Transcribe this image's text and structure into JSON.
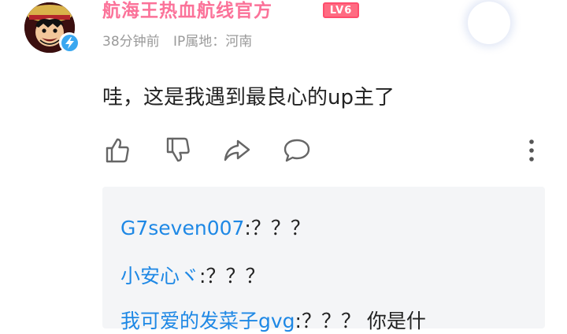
{
  "user": {
    "name": "航海王热血航线官方",
    "level": "LV6",
    "time": "38分钟前",
    "ip": "IP属地：河南"
  },
  "comment": {
    "text": "哇，这是我遇到最良心的up主了"
  },
  "actions": {
    "like": "like-icon",
    "dislike": "dislike-icon",
    "share": "share-icon",
    "reply": "comment-icon",
    "more": "more-vertical-icon"
  },
  "replies": [
    {
      "name": "G7seven007",
      "text": ":？？？"
    },
    {
      "name": "小安心ヾ",
      "text": ":？？？"
    },
    {
      "name": "我可爱的发菜子gvg",
      "text": ":？？？ 你是什"
    }
  ],
  "colors": {
    "username": "#fb7299",
    "reply_name": "#1e88e5",
    "meta": "#9a9a9a",
    "reply_bg": "#f4f5f7"
  }
}
